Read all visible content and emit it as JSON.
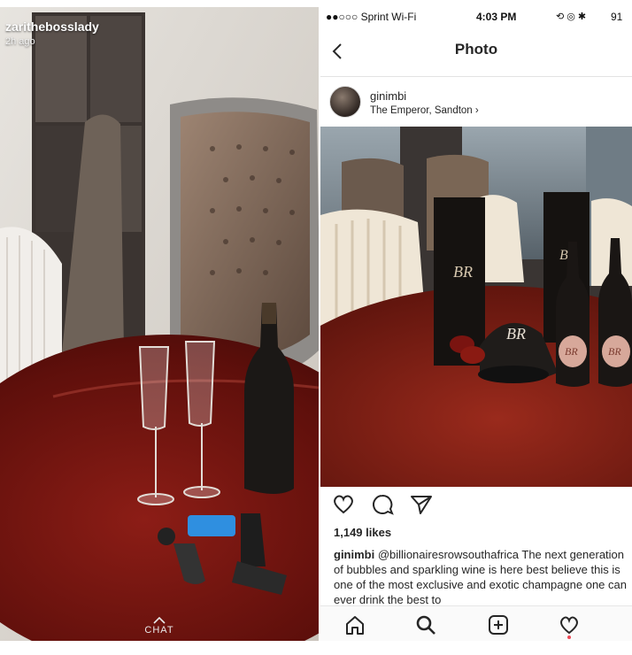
{
  "snap": {
    "username": "zarithebosslady",
    "time": "2h ago",
    "chat_label": "CHAT"
  },
  "instagram": {
    "status": {
      "carrier": "●●○○○ Sprint Wi-Fi",
      "time": "4:03 PM",
      "battery": "91"
    },
    "nav": {
      "title": "Photo"
    },
    "post": {
      "username": "ginimbi",
      "location": "The Emperor, Sandton",
      "likes": "1,149 likes",
      "caption_user": "ginimbi",
      "caption_handle": "@billionairesrowsouthafrica",
      "caption_text": " The next generation of bubbles and sparkling wine is here best believe this is one of the most exclusive and exotic champagne one can ever drink the best to"
    },
    "icons": [
      "heart-icon",
      "comment-icon",
      "share-icon",
      "home-icon",
      "search-icon",
      "add-icon",
      "activity-icon"
    ]
  }
}
